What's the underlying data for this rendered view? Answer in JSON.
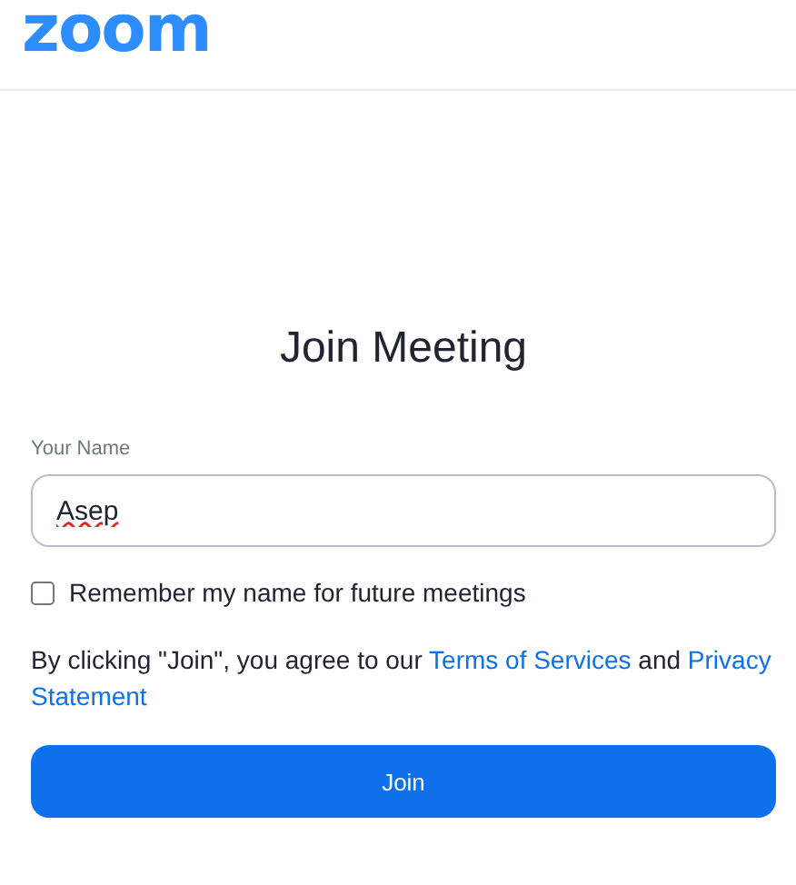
{
  "header": {
    "logo": "zoom"
  },
  "title": "Join Meeting",
  "name_field": {
    "label": "Your Name",
    "value": "Asep",
    "spellcheck_error": true
  },
  "remember": {
    "label": "Remember my name for future meetings",
    "checked": false
  },
  "agreement": {
    "before": "By clicking \"Join\", you agree to our ",
    "terms_link": "Terms of Services",
    "middle": " and ",
    "privacy_link_lines": [
      "Privacy",
      "Statement"
    ]
  },
  "join_button": "Join"
}
